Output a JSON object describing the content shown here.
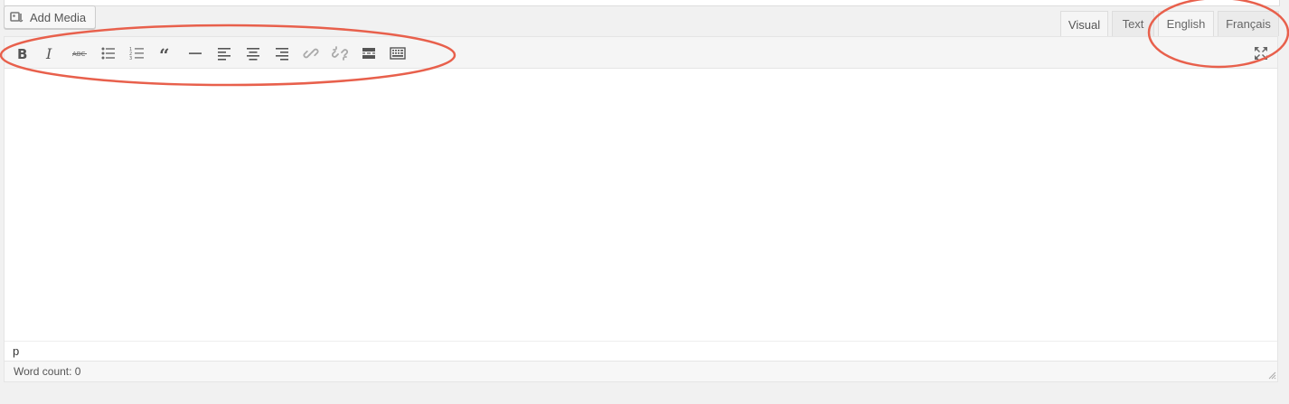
{
  "media": {
    "add_media_label": "Add Media"
  },
  "tabs": [
    {
      "label": "Visual",
      "active": true
    },
    {
      "label": "Text",
      "active": false
    },
    {
      "label": "English",
      "active": false
    },
    {
      "label": "Français",
      "active": false
    }
  ],
  "toolbar": {
    "buttons": [
      "bold-icon",
      "italic-icon",
      "strikethrough-icon",
      "bulleted-list-icon",
      "numbered-list-icon",
      "blockquote-icon",
      "horizontal-rule-icon",
      "align-left-icon",
      "align-center-icon",
      "align-right-icon",
      "insert-link-icon",
      "remove-link-icon",
      "read-more-icon",
      "toolbar-toggle-icon"
    ],
    "expand_icon": "fullscreen-icon"
  },
  "editor": {
    "path_text": "p",
    "word_count_label": "Word count: 0"
  },
  "colors": {
    "annotation": "#e8604c",
    "toolbar_bg": "#f5f5f5",
    "page_bg": "#f1f1f1"
  }
}
